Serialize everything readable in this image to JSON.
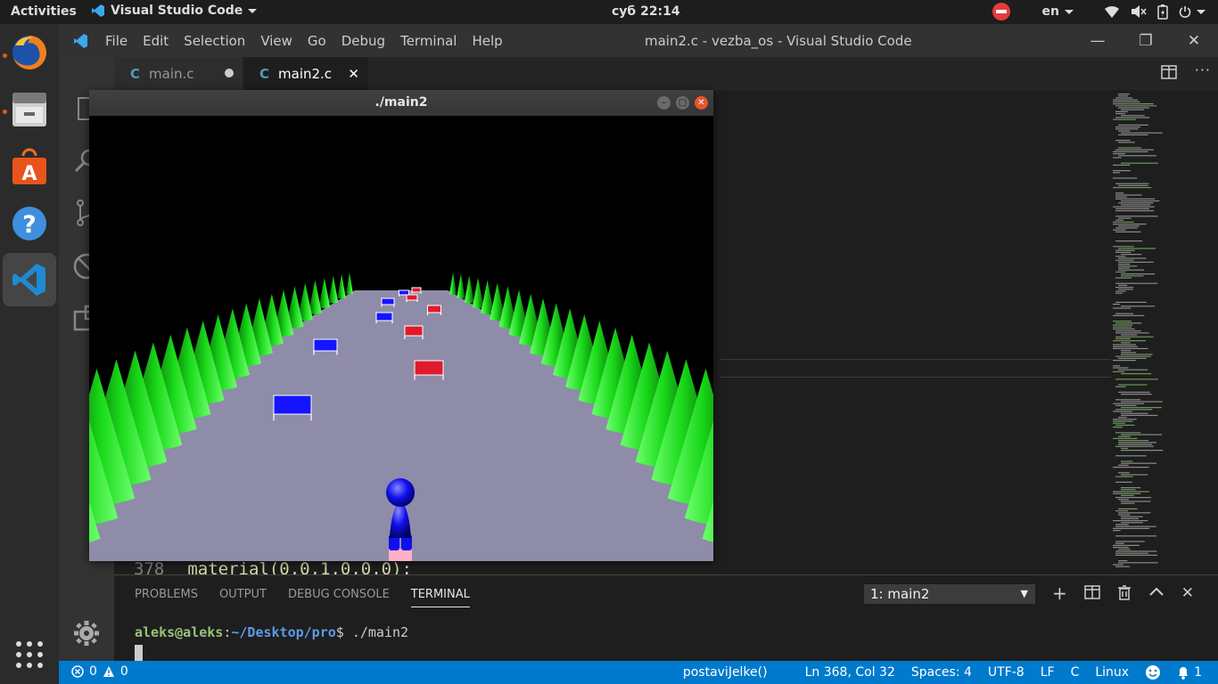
{
  "topbar": {
    "activities": "Activities",
    "app": "Visual Studio Code",
    "clock": "суб 22:14",
    "lang": "en",
    "icons": [
      "do-not-disturb-icon",
      "wifi-icon",
      "volume-muted-icon",
      "battery-icon",
      "power-icon"
    ]
  },
  "dock": {
    "items": [
      "firefox-icon",
      "files-icon",
      "software-store-icon",
      "help-icon",
      "vscode-icon",
      "app-grid-icon"
    ]
  },
  "vscode": {
    "menu": [
      "File",
      "Edit",
      "Selection",
      "View",
      "Go",
      "Debug",
      "Terminal",
      "Help"
    ],
    "window_title": "main2.c - vezba_os - Visual Studio Code",
    "tabs": [
      {
        "icon": "C",
        "label": "main.c",
        "modified": true
      },
      {
        "icon": "C",
        "label": "main2.c",
        "modified": false
      }
    ],
    "editor": {
      "line_number": "378",
      "line_text": "material(0,0,1,0,0,0);"
    },
    "panel": {
      "tabs": [
        "PROBLEMS",
        "OUTPUT",
        "DEBUG CONSOLE",
        "TERMINAL"
      ],
      "active_tab": "TERMINAL",
      "terminal_select": "1: main2",
      "prompt_user": "aleks@aleks",
      "prompt_sep": ":",
      "prompt_path": "~/Desktop/pro",
      "prompt_cmd": "$ ./main2"
    },
    "status": {
      "errors": "0",
      "warnings": "0",
      "function": "postaviJelke()",
      "position": "Ln 368, Col 32",
      "spaces": "Spaces: 4",
      "encoding": "UTF-8",
      "eol": "LF",
      "language": "C",
      "platform": "Linux",
      "notifications": "1"
    }
  },
  "game": {
    "title": "./main2",
    "colors": {
      "sky": "#000000",
      "road": "#8e8ca8",
      "trees": "#19ea19",
      "obstacle_blue": "#1414ff",
      "obstacle_red": "#e01a2d",
      "player": "#1010ee"
    }
  }
}
